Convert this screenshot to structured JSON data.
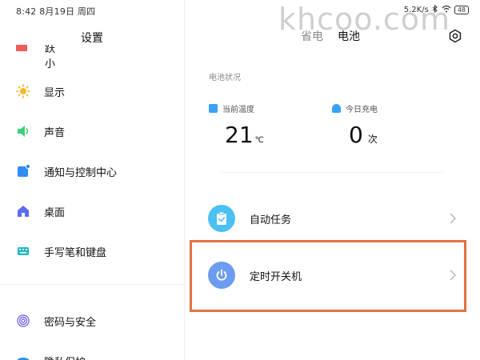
{
  "status_bar": {
    "time": "8:42",
    "date": "8月19日",
    "weekday": "周四",
    "net_speed": "5.2K/s",
    "battery": "48"
  },
  "watermark": "khcoo.com",
  "left_panel": {
    "title": "设置",
    "partial_top_item": "跃小",
    "items": [
      {
        "label": "显示",
        "icon": "sun-icon",
        "color": "#f5b82e"
      },
      {
        "label": "声音",
        "icon": "speaker-icon",
        "color": "#3ccf7a"
      },
      {
        "label": "通知与控制中心",
        "icon": "notification-icon",
        "color": "#2f8df5"
      },
      {
        "label": "桌面",
        "icon": "home-icon",
        "color": "#5b6cf0"
      },
      {
        "label": "手写笔和键盘",
        "icon": "keyboard-icon",
        "color": "#25b9c4"
      },
      {
        "label": "密码与安全",
        "icon": "fingerprint-icon",
        "color": "#7a6cf0"
      }
    ],
    "partial_bottom_item": "隐私保护"
  },
  "right_panel": {
    "tabs": [
      {
        "label": "省电",
        "active": false
      },
      {
        "label": "电池",
        "active": true
      }
    ],
    "section_label": "电池状况",
    "metrics": [
      {
        "label": "当前温度",
        "value": "21",
        "unit": "℃",
        "icon": "thermometer-icon"
      },
      {
        "label": "今日充电",
        "value": "0",
        "unit": "次",
        "icon": "plug-icon"
      }
    ],
    "rows": [
      {
        "label": "自动任务",
        "icon": "clipboard-check-icon",
        "color": "#4ac0f5"
      },
      {
        "label": "定时开关机",
        "icon": "power-icon",
        "color": "#6c9cf0"
      }
    ]
  },
  "highlight_color": "#e2743f"
}
